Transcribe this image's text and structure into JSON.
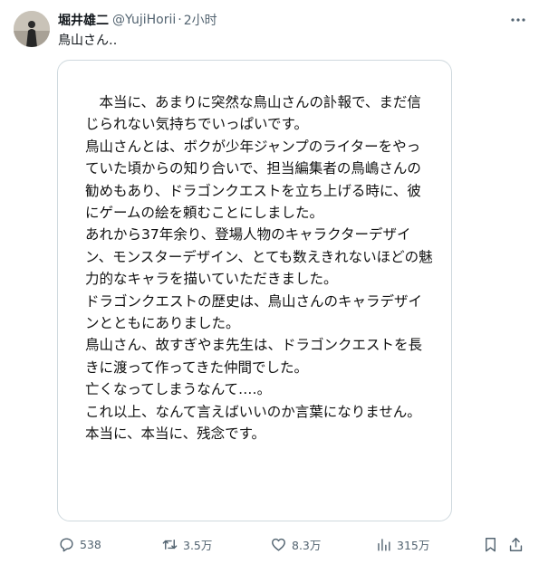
{
  "tweet": {
    "author_name": "堀井雄二",
    "handle": "@YujiHorii",
    "separator": "·",
    "time": "2小时",
    "text": "鳥山さん‥",
    "more_icon": "more-horizontal-icon"
  },
  "card": {
    "letter": "　本当に、あまりに突然な鳥山さんの訃報で、まだ信じられない気持ちでいっぱいです。\n鳥山さんとは、ボクが少年ジャンプのライターをやっていた頃からの知り合いで、担当編集者の鳥嶋さんの勧めもあり、ドラゴンクエストを立ち上げる時に、彼にゲームの絵を頼むことにしました。\nあれから37年余り、登場人物のキャラクターデザイン、モンスターデザイン、とても数えきれないほどの魅力的なキャラを描いていただきました。\nドラゴンクエストの歴史は、鳥山さんのキャラデザインとともにありました。\n鳥山さん、故すぎやま先生は、ドラゴンクエストを長きに渡って作ってきた仲間でした。\n亡くなってしまうなんて‥‥。\nこれ以上、なんて言えばいいのか言葉になりません。本当に、本当に、残念です。"
  },
  "actions": {
    "replies": "538",
    "retweets": "3.5万",
    "likes": "8.3万",
    "views": "315万"
  }
}
